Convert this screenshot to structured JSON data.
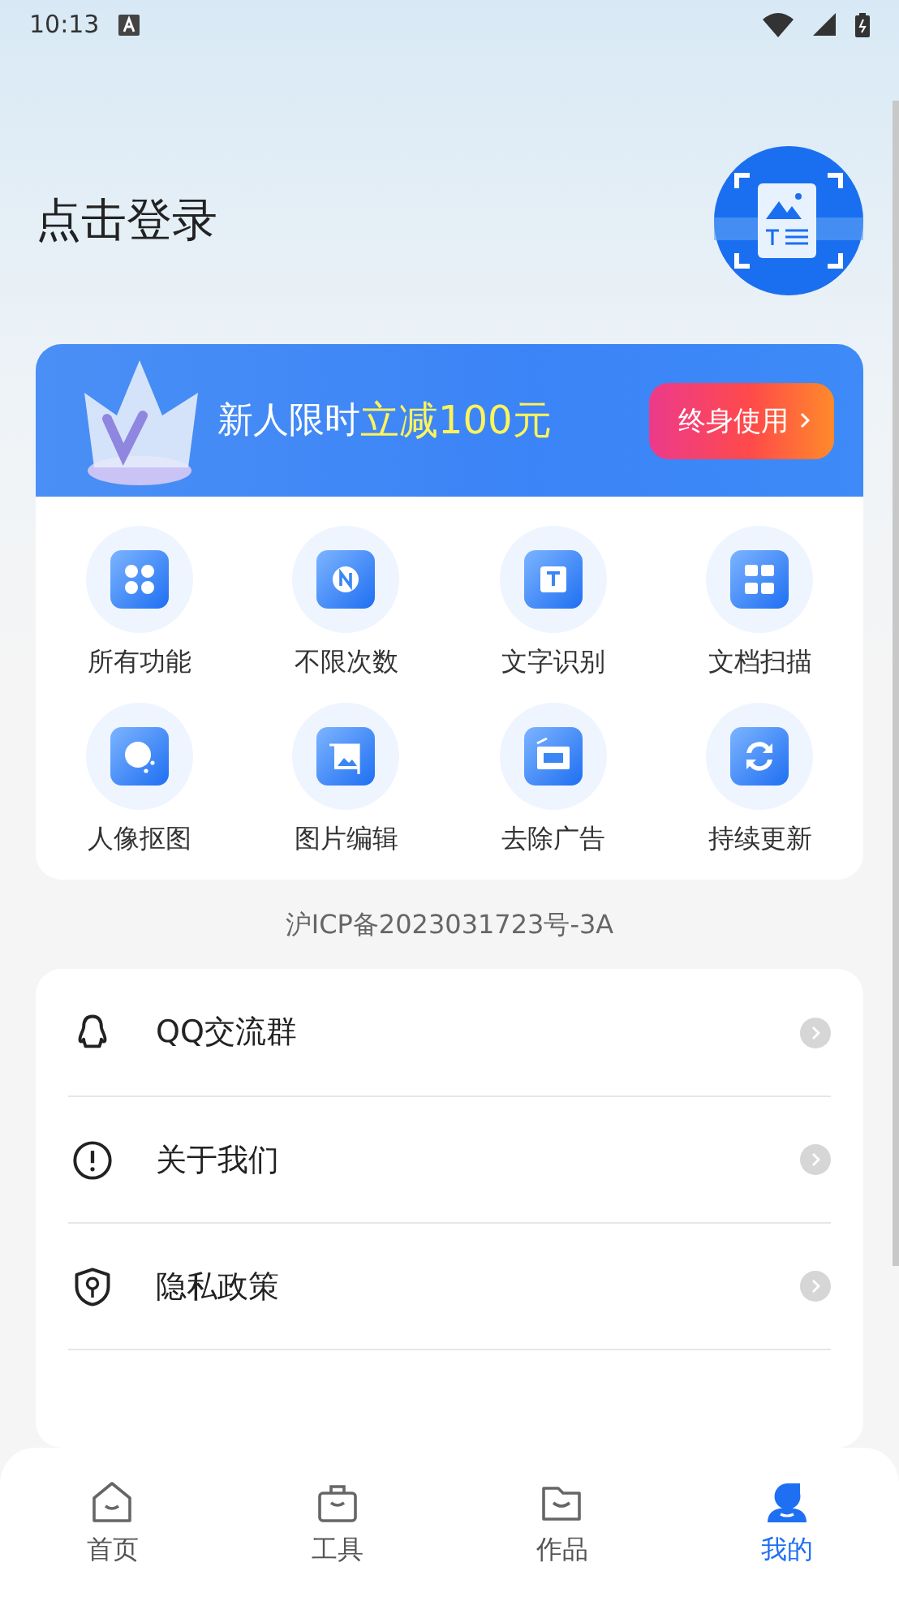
{
  "status_bar": {
    "time": "10:13"
  },
  "profile": {
    "login_label": "点击登录"
  },
  "promo": {
    "text": "新人限时",
    "highlight": "立减100元",
    "button": "终身使用"
  },
  "features": [
    {
      "label": "所有功能"
    },
    {
      "label": "不限次数"
    },
    {
      "label": "文字识别"
    },
    {
      "label": "文档扫描"
    },
    {
      "label": "人像抠图"
    },
    {
      "label": "图片编辑"
    },
    {
      "label": "去除广告"
    },
    {
      "label": "持续更新"
    }
  ],
  "icp": "沪ICP备2023031723号-3A",
  "menu": [
    {
      "label": "QQ交流群"
    },
    {
      "label": "关于我们"
    },
    {
      "label": "隐私政策"
    }
  ],
  "nav": [
    {
      "label": "首页",
      "selected": false
    },
    {
      "label": "工具",
      "selected": false
    },
    {
      "label": "作品",
      "selected": false
    },
    {
      "label": "我的",
      "selected": true
    }
  ]
}
